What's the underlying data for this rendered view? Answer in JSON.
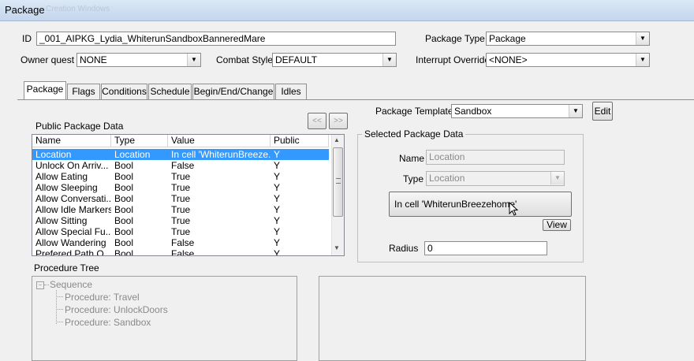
{
  "window": {
    "title": "Package",
    "ghost_title": "Creation Windows"
  },
  "header": {
    "id_label": "ID",
    "id_value": "_001_AIPKG_Lydia_WhiterunSandboxBanneredMare",
    "owner_quest_label": "Owner quest",
    "owner_quest_value": "NONE",
    "combat_style_label": "Combat Style",
    "combat_style_value": "DEFAULT",
    "package_type_label": "Package Type",
    "package_type_value": "Package",
    "interrupt_override_label": "Interrupt Override",
    "interrupt_override_value": "<NONE>"
  },
  "tabs": [
    {
      "label": "Package"
    },
    {
      "label": "Flags"
    },
    {
      "label": "Conditions"
    },
    {
      "label": "Schedule"
    },
    {
      "label": "Begin/End/Change"
    },
    {
      "label": "Idles"
    }
  ],
  "public_data": {
    "label": "Public Package Data",
    "prev_label": "<<",
    "next_label": ">>",
    "columns": [
      "Name",
      "Type",
      "Value",
      "Public"
    ],
    "rows": [
      [
        "Location",
        "Location",
        "In cell 'WhiterunBreeze...",
        "Y"
      ],
      [
        "Unlock On Arriv...",
        "Bool",
        "False",
        "Y"
      ],
      [
        "Allow Eating",
        "Bool",
        "True",
        "Y"
      ],
      [
        "Allow Sleeping",
        "Bool",
        "True",
        "Y"
      ],
      [
        "Allow Conversati...",
        "Bool",
        "True",
        "Y"
      ],
      [
        "Allow Idle Markers",
        "Bool",
        "True",
        "Y"
      ],
      [
        "Allow Sitting",
        "Bool",
        "True",
        "Y"
      ],
      [
        "Allow Special Fu...",
        "Bool",
        "True",
        "Y"
      ],
      [
        "Allow Wandering",
        "Bool",
        "False",
        "Y"
      ],
      [
        "Prefered Path O...",
        "Bool",
        "False",
        "Y"
      ]
    ],
    "selected_row": 0
  },
  "template": {
    "label": "Package Template",
    "value": "Sandbox",
    "edit_label": "Edit"
  },
  "selected_data": {
    "group_label": "Selected Package Data",
    "name_label": "Name",
    "name_value": "Location",
    "type_label": "Type",
    "type_value": "Location",
    "location_button": "In cell 'WhiterunBreezehome'",
    "view_label": "View",
    "radius_label": "Radius",
    "radius_value": "0"
  },
  "procedure_tree": {
    "label": "Procedure Tree",
    "root": "Sequence",
    "items": [
      "Procedure: Travel",
      "Procedure: UnlockDoors",
      "Procedure: Sandbox"
    ]
  }
}
